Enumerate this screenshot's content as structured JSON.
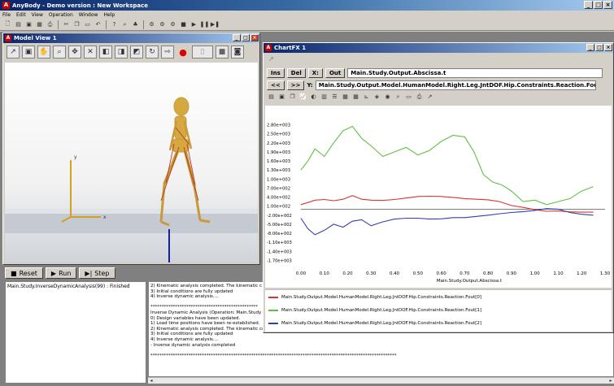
{
  "app": {
    "title": "AnyBody - Demo version : New Workspace",
    "menu": [
      "File",
      "Edit",
      "View",
      "Operation",
      "Window",
      "Help"
    ],
    "toolbar_icons": [
      "new-icon",
      "open-icon",
      "save-icon",
      "save-all-icon",
      "print-icon",
      "cut-icon",
      "copy-icon",
      "paste-icon",
      "undo-icon",
      "help-icon",
      "find-icon",
      "model-tree-icon",
      "run-icon",
      "stop-icon",
      "play-icon",
      "pause-icon",
      "step-icon"
    ]
  },
  "model_view": {
    "title": "Model View 1",
    "axis_labels": {
      "x": "x",
      "y": "y",
      "z": "z"
    },
    "tool_icons": [
      "select-icon",
      "pan-icon",
      "rotate-icon",
      "zoom-icon",
      "zoom-fit-icon",
      "view-front-icon",
      "view-side-icon",
      "view-top-icon",
      "camera-icon",
      "record-icon",
      "stop-icon",
      "snapshot-icon"
    ]
  },
  "controls": {
    "reset_label": "Reset",
    "run_label": "Run",
    "step_label": "Step"
  },
  "tasks": [
    "Main.Study.InverseDynamicAnalysis(99) : Finished"
  ],
  "log_lines": [
    "2) Kinematic analysis completed. The kinematic c",
    "3) Initial conditions are fully updated",
    "4) Inverse dynamic analysis....",
    "",
    "************************************************",
    "Inverse Dynamic Analysis (Operation: Main.Study",
    "0) Design variables have been updated.",
    "1) Load time positions have been re-established.",
    "2) Kinematic analysis completed. The kinematic constraints have been resolved.",
    "3) Initial conditions are fully updated",
    "4) Inverse dynamic analysis....",
    "- Inverse dynamic analysis completed",
    "",
    "**************************************************************************************************************"
  ],
  "chartfx": {
    "title": "ChartFX 1",
    "ins_label": "Ins",
    "del_label": "Del",
    "x_label": "X:",
    "out_label": "Out",
    "abscissa_value": "Main.Study.Output.Abscissa.t",
    "y_label": "Y:",
    "ordinate_value": "Main.Study.Output.Model.HumanModel.Right.Leg.JntDOF.Hip.Constraints.Reaction.Fout",
    "nav_prev": "<<",
    "nav_next": ">>"
  },
  "chart_data": {
    "type": "line",
    "xlabel": "Main.Study.Output.Abscissa.t",
    "x_ticks": [
      "0.00",
      "0.10",
      "0.20",
      "0.30",
      "0.40",
      "0.50",
      "0.60",
      "0.70",
      "0.80",
      "0.90",
      "1.00",
      "1.10",
      "1.20",
      "1.30"
    ],
    "y_ticks": [
      "2.80e+003",
      "2.50e+003",
      "2.20e+003",
      "1.90e+003",
      "1.60e+003",
      "1.30e+003",
      "1.00e+003",
      "7.00e+002",
      "4.00e+002",
      "1.00e+002",
      "-2.00e+002",
      "-5.00e+002",
      "-8.00e+002",
      "-1.10e+003",
      "-1.40e+003",
      "-1.70e+003"
    ],
    "xlim": [
      0,
      1.3
    ],
    "ylim": [
      -1850,
      2950
    ],
    "series": [
      {
        "name": "Main.Study.Output.Model.HumanModel.Right.Leg.JntDOF.Hip.Constraints.Reaction.Fout[0]",
        "color": "#e03030",
        "x": [
          0,
          0.03,
          0.06,
          0.1,
          0.14,
          0.18,
          0.22,
          0.26,
          0.3,
          0.35,
          0.4,
          0.45,
          0.5,
          0.55,
          0.6,
          0.65,
          0.7,
          0.75,
          0.8,
          0.85,
          0.9,
          0.95,
          1.0,
          1.05,
          1.1,
          1.15,
          1.2,
          1.25
        ],
        "y": [
          150,
          220,
          300,
          320,
          280,
          330,
          450,
          330,
          300,
          290,
          320,
          370,
          420,
          430,
          420,
          390,
          350,
          330,
          310,
          250,
          120,
          60,
          -20,
          -70,
          -60,
          -90,
          -100,
          -100
        ]
      },
      {
        "name": "Main.Study.Output.Model.HumanModel.Right.Leg.JntDOF.Hip.Constraints.Reaction.Fout[1]",
        "color": "#60c040",
        "x": [
          0,
          0.03,
          0.06,
          0.1,
          0.14,
          0.18,
          0.22,
          0.26,
          0.3,
          0.35,
          0.4,
          0.45,
          0.5,
          0.55,
          0.6,
          0.65,
          0.7,
          0.74,
          0.78,
          0.82,
          0.86,
          0.9,
          0.95,
          1.0,
          1.05,
          1.1,
          1.15,
          1.2,
          1.25
        ],
        "y": [
          1300,
          1600,
          2000,
          1750,
          2200,
          2600,
          2750,
          2350,
          2100,
          1750,
          1900,
          2050,
          1800,
          1950,
          2250,
          2450,
          2400,
          1900,
          1150,
          900,
          800,
          600,
          250,
          300,
          150,
          250,
          350,
          600,
          750
        ]
      },
      {
        "name": "Main.Study.Output.Model.HumanModel.Right.Leg.JntDOF.Hip.Constraints.Reaction.Fout[2]",
        "color": "#3040b0",
        "x": [
          0,
          0.03,
          0.06,
          0.1,
          0.14,
          0.18,
          0.22,
          0.26,
          0.3,
          0.35,
          0.4,
          0.45,
          0.5,
          0.55,
          0.6,
          0.65,
          0.7,
          0.75,
          0.8,
          0.85,
          0.9,
          0.95,
          1.0,
          1.05,
          1.1,
          1.15,
          1.2,
          1.25
        ],
        "y": [
          -300,
          -650,
          -850,
          -700,
          -500,
          -600,
          -400,
          -350,
          -550,
          -420,
          -330,
          -300,
          -300,
          -330,
          -320,
          -280,
          -280,
          -240,
          -200,
          -150,
          -110,
          -80,
          -40,
          20,
          0,
          -110,
          -170,
          -200
        ]
      }
    ],
    "legend_placement": "bottom"
  }
}
